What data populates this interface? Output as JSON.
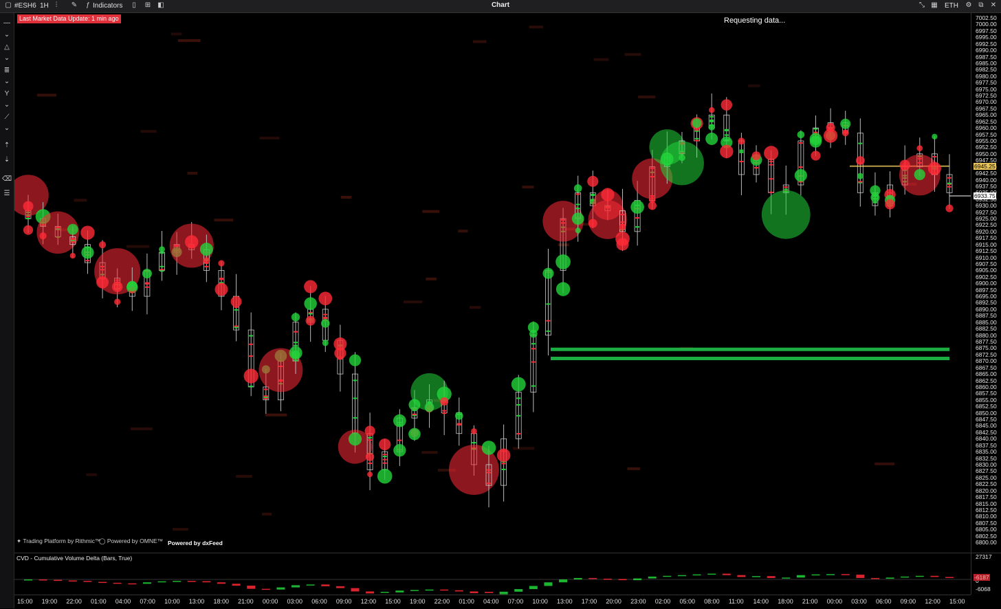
{
  "titlebar": {
    "symbol": "#ESH6",
    "interval": "1H",
    "indicators_label": "Indicators",
    "window_title": "Chart",
    "session": "ETH"
  },
  "status": {
    "market_update": "Last Market Data Update: 1 min ago",
    "requesting": "Requesting data..."
  },
  "watermarks": {
    "rithmic": "Trading Platform by Rithmic™",
    "omne": "Powered by OMNE™",
    "dxfeed": "Powered by dxFeed"
  },
  "price_axis": {
    "labels": [
      "7002.50",
      "7000.00",
      "6997.50",
      "6995.00",
      "6992.50",
      "6990.00",
      "6987.50",
      "6985.00",
      "6982.50",
      "6980.00",
      "6977.50",
      "6975.00",
      "6972.50",
      "6970.00",
      "6967.50",
      "6965.00",
      "6962.50",
      "6960.00",
      "6957.50",
      "6955.00",
      "6952.50",
      "6950.00",
      "6947.50",
      "6945.00",
      "6942.50",
      "6940.00",
      "6937.50",
      "6935.00",
      "6932.50",
      "6930.00",
      "6927.50",
      "6925.00",
      "6922.50",
      "6920.00",
      "6917.50",
      "6915.00",
      "6912.50",
      "6910.00",
      "6907.50",
      "6905.00",
      "6902.50",
      "6900.00",
      "6897.50",
      "6695.00",
      "6892.50",
      "6890.00",
      "6887.50",
      "6885.00",
      "6882.50",
      "6880.00",
      "6877.50",
      "6875.00",
      "6872.50",
      "6870.00",
      "6867.50",
      "6865.00",
      "6862.50",
      "6860.00",
      "6857.50",
      "6855.00",
      "6852.50",
      "6850.00",
      "6847.50",
      "6845.00",
      "6842.50",
      "6840.00",
      "6837.50",
      "6835.00",
      "6832.50",
      "6830.00",
      "6827.50",
      "6825.00",
      "6822.50",
      "6820.00",
      "6817.50",
      "6815.00",
      "6812.50",
      "6810.00",
      "6807.50",
      "6805.00",
      "6802.50",
      "6800.00"
    ],
    "highlight_yellow": "6945.25",
    "highlight_white": "6933.75",
    "yellow_color": "#e8c45a",
    "white_color": "#ffffff"
  },
  "cvd": {
    "title": "CVD - Cumulative Volume Delta (Bars, True)",
    "axis_top": "27317",
    "axis_zero": "0",
    "current_badge": "-6187",
    "axis_bottom": "-6068"
  },
  "time_axis": {
    "labels": [
      "15:00",
      "19:00",
      "22:00",
      "01:00",
      "04:00",
      "07:00",
      "10:00",
      "13:00",
      "18:00",
      "21:00",
      "00:00",
      "03:00",
      "06:00",
      "09:00",
      "12:00",
      "15:00",
      "19:00",
      "22:00",
      "01:00",
      "04:00",
      "07:00",
      "10:00",
      "13:00",
      "17:00",
      "20:00",
      "23:00",
      "02:00",
      "05:00",
      "08:00",
      "11:00",
      "14:00",
      "18:00",
      "21:00",
      "00:00",
      "03:00",
      "06:00",
      "09:00",
      "12:00",
      "15:00"
    ]
  },
  "colors": {
    "up": "#22d33a",
    "down": "#ff2a36",
    "level_line": "#1fbf4a",
    "background": "#000000"
  },
  "chart_data": {
    "type": "candlestick-footprint",
    "symbol": "#ESH6",
    "timeframe": "1H",
    "y_range": [
      6800.0,
      7002.5
    ],
    "approx_closes": [
      6925,
      6922,
      6918,
      6915,
      6908,
      6902,
      6898,
      6895,
      6905,
      6912,
      6915,
      6913,
      6905,
      6895,
      6882,
      6860,
      6855,
      6870,
      6885,
      6890,
      6878,
      6865,
      6842,
      6828,
      6835,
      6848,
      6852,
      6855,
      6850,
      6842,
      6830,
      6822,
      6840,
      6858,
      6880,
      6905,
      6925,
      6935,
      6930,
      6928,
      6920,
      6932,
      6945,
      6950,
      6955,
      6960,
      6965,
      6955,
      6942,
      6948,
      6935,
      6938,
      6955,
      6960,
      6962,
      6958,
      6935,
      6930,
      6938,
      6945,
      6950,
      6942,
      6935
    ],
    "levels": [
      6874.5,
      6871.0,
      6945.25
    ]
  }
}
